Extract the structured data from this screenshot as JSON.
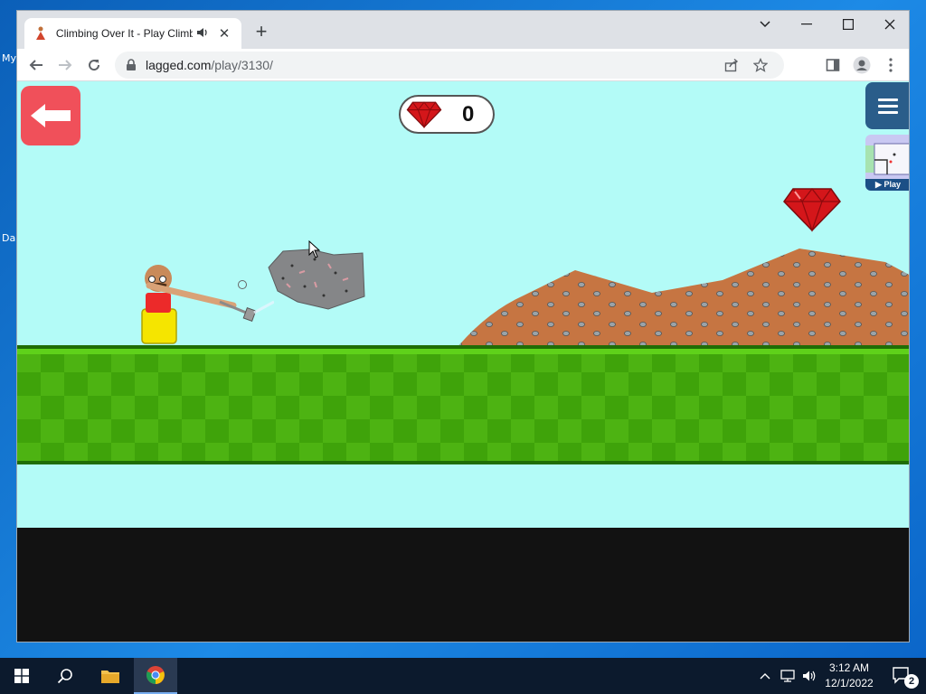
{
  "desktop": {
    "icon_label_1": "My",
    "icon_label_2": "Da"
  },
  "browser": {
    "tab_title": "Climbing Over It - Play Climb",
    "url_host": "lagged.com",
    "url_path": "/play/3130/"
  },
  "game": {
    "gem_count": "0",
    "play_label": "▶ Play"
  },
  "taskbar": {
    "time": "3:12 AM",
    "date": "12/1/2022",
    "notification_count": "2"
  },
  "colors": {
    "sky": "#b3fbf7",
    "grass": "#4db312",
    "back_button": "#f0505a",
    "menu_button": "#2a5d8a",
    "dirt": "#c67542",
    "gem": "#d4161a"
  },
  "icons": [
    "back-arrow-icon",
    "gem-icon",
    "hamburger-menu-icon",
    "windows-start-icon",
    "search-icon",
    "file-explorer-icon",
    "chrome-icon",
    "chevron-up-icon",
    "network-icon",
    "volume-icon",
    "notification-icon"
  ]
}
